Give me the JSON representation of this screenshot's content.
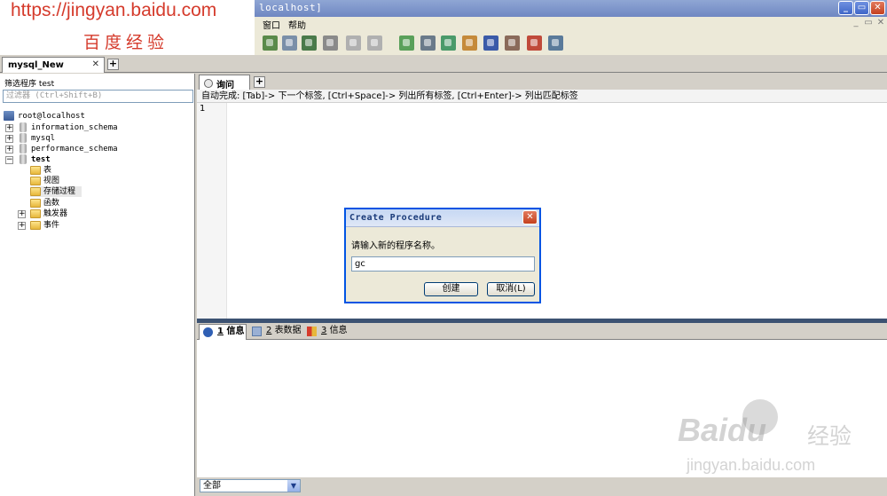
{
  "window": {
    "title_fragment": "localhost]"
  },
  "menu": [
    "窗口",
    "帮助"
  ],
  "watermark": {
    "url": "https://jingyan.baidu.com",
    "name": "百度经验"
  },
  "connection_tab": {
    "label": "mysql_New"
  },
  "sidebar": {
    "filter_label": "筛选程序 test",
    "filter_placeholder": "过滤器 (Ctrl+Shift+B)",
    "root": "root@localhost",
    "databases": [
      "information_schema",
      "mysql",
      "performance_schema",
      "test"
    ],
    "test_children": [
      "表",
      "视图",
      "存储过程",
      "函数",
      "触发器",
      "事件"
    ]
  },
  "query": {
    "tab_label": "询问",
    "hint": "自动完成: [Tab]-> 下一个标签, [Ctrl+Space]-> 列出所有标签, [Ctrl+Enter]-> 列出匹配标签",
    "line_number": "1"
  },
  "result_tabs": [
    {
      "num": "1",
      "label": "信息"
    },
    {
      "num": "2",
      "label": "表数据"
    },
    {
      "num": "3",
      "label": "信息"
    }
  ],
  "bottom": {
    "filter_value": "全部"
  },
  "dialog": {
    "title": "Create Procedure",
    "prompt": "请输入新的程序名称。",
    "input_value": "gc",
    "ok_label": "创建",
    "cancel_label": "取消(L)"
  },
  "baidu_watermark": {
    "logo": "Baidu",
    "cn": "经验",
    "url": "jingyan.baidu.com"
  },
  "colors": {
    "splitter": "#3c5272",
    "dialog_border": "#0054e3",
    "watermark_red": "#d53b2c"
  }
}
